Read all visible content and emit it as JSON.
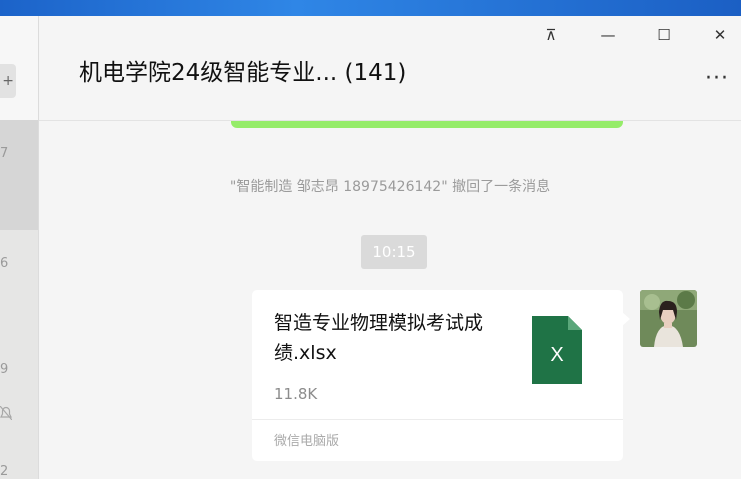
{
  "window": {
    "title": "机电学院24级智能专业... (141)",
    "pin_glyph": "⊼",
    "minimize_glyph": "—",
    "maximize_glyph": "☐",
    "close_glyph": "✕",
    "more_glyph": "···"
  },
  "sidebar": {
    "button_glyph": "+",
    "partial_numbers": [
      "7",
      "6",
      "9",
      "2"
    ]
  },
  "messages": {
    "recall_notice": "\"智能制造 邹志昂 18975426142\" 撤回了一条消息",
    "timestamp": "10:15",
    "file": {
      "name": "智造专业物理模拟考试成绩.xlsx",
      "size": "11.8K",
      "source": "微信电脑版",
      "icon_letter": "X",
      "icon": "excel-file-icon"
    }
  },
  "colors": {
    "sent_bubble": "#95ec69",
    "excel_green": "#1f7346",
    "window_bg": "#f5f5f5"
  }
}
